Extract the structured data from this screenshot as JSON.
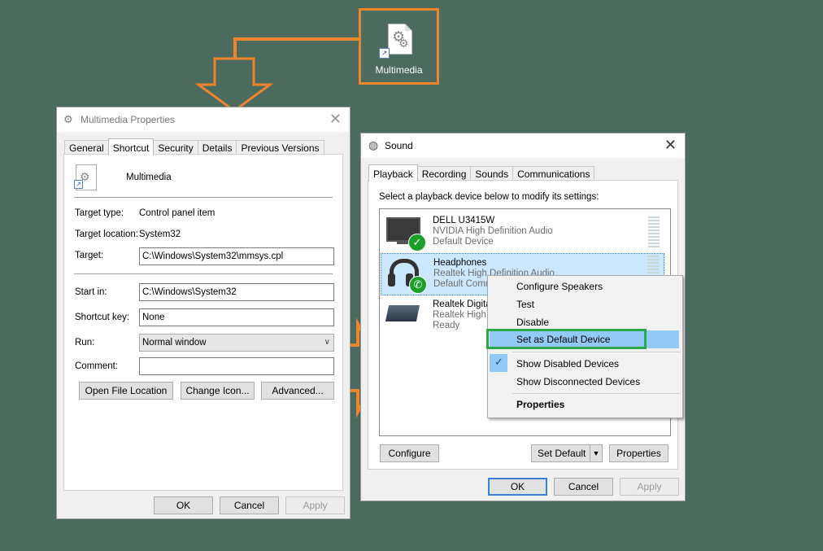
{
  "desktop": {
    "icon_label": "Multimedia"
  },
  "properties": {
    "title": "Multimedia Properties",
    "tabs": [
      "General",
      "Shortcut",
      "Security",
      "Details",
      "Previous Versions"
    ],
    "shortcut_name": "Multimedia",
    "target_type_label": "Target type:",
    "target_type_value": "Control panel item",
    "target_location_label": "Target location:",
    "target_location_value": "System32",
    "target_label": "Target:",
    "target_value": "C:\\Windows\\System32\\mmsys.cpl",
    "start_in_label": "Start in:",
    "start_in_value": "C:\\Windows\\System32",
    "shortcut_key_label": "Shortcut key:",
    "shortcut_key_value": "None",
    "run_label": "Run:",
    "run_value": "Normal window",
    "comment_label": "Comment:",
    "comment_value": "",
    "open_file_location": "Open File Location",
    "change_icon": "Change Icon...",
    "advanced": "Advanced...",
    "ok": "OK",
    "cancel": "Cancel",
    "apply": "Apply"
  },
  "sound": {
    "title": "Sound",
    "tabs": [
      "Playback",
      "Recording",
      "Sounds",
      "Communications"
    ],
    "instruction": "Select a playback device below to modify its settings:",
    "devices": [
      {
        "name": "DELL U3415W",
        "driver": "NVIDIA High Definition Audio",
        "status": "Default Device"
      },
      {
        "name": "Headphones",
        "driver": "Realtek High Definition Audio",
        "status": "Default Communications Device"
      },
      {
        "name": "Realtek Digital Output",
        "driver": "Realtek High Definition Audio",
        "status": "Ready"
      }
    ],
    "configure": "Configure",
    "set_default": "Set Default",
    "properties": "Properties",
    "ok": "OK",
    "cancel": "Cancel",
    "apply": "Apply"
  },
  "context_menu": {
    "items": [
      "Configure Speakers",
      "Test",
      "Disable",
      "Set as Default Device",
      "Show Disabled Devices",
      "Show Disconnected Devices",
      "Properties"
    ]
  },
  "colors": {
    "accent_orange": "#f0842a",
    "highlight_green": "#2aa84a",
    "menu_highlight": "#91c9f7",
    "background": "#4b6b5f"
  }
}
